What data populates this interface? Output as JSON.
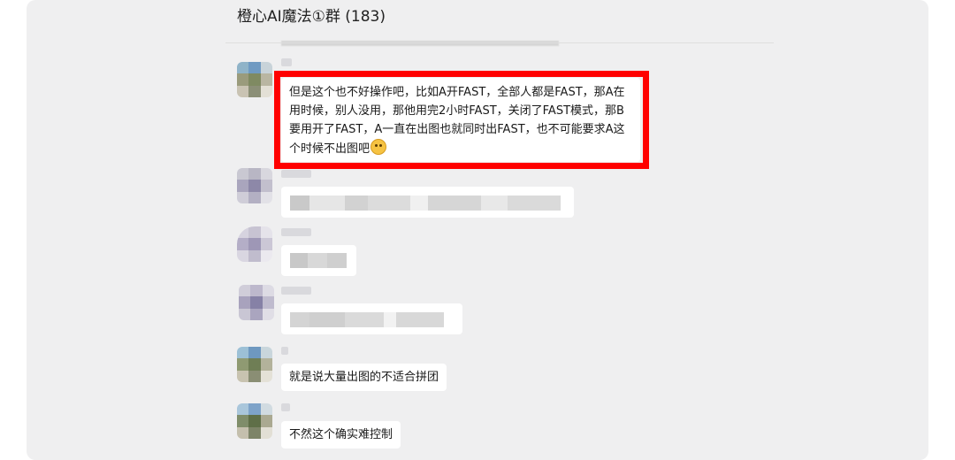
{
  "chat": {
    "title": "橙心AI魔法①群 (183)"
  },
  "messages": [
    {
      "text": "但是这个也不好操作吧，比如A开FAST，全部人都是FAST，那A在用时候，别人没用，那他用完2小时FAST，关闭了FAST模式，那B要用开了FAST，A一直在出图也就同时出FAST，也不可能要求A这个时候不出图吧",
      "emoji": "flushed-face-emoji",
      "highlighted": true,
      "highlight_color": "#ff0000"
    },
    {
      "text": "",
      "redacted": true
    },
    {
      "text": "",
      "redacted": true
    },
    {
      "text": "",
      "redacted": true
    },
    {
      "text": "就是说大量出图的不适合拼团"
    },
    {
      "text": "不然这个确实难控制"
    }
  ],
  "colors": {
    "panel_bg": "#efeff0",
    "bubble_bg": "#ffffff",
    "highlight": "#ff0000"
  }
}
